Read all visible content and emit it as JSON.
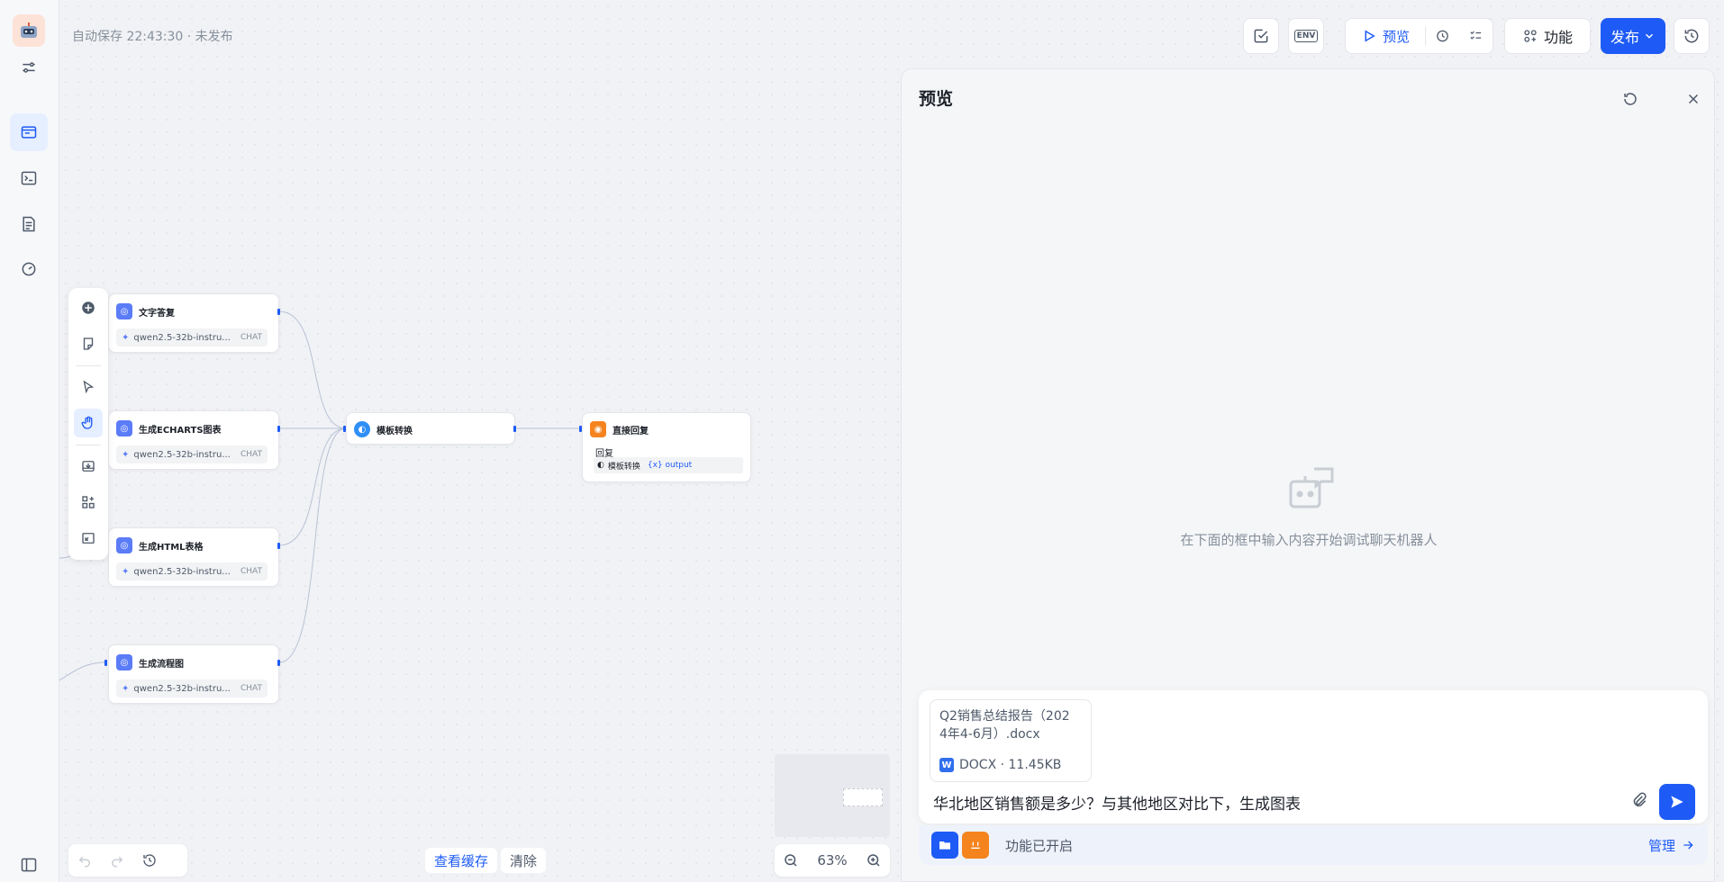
{
  "header": {
    "autosave": "自动保存 22:43:30 · 未发布",
    "env_label": "ENV",
    "preview_label": "预览",
    "function_label": "功能",
    "publish_label": "发布"
  },
  "canvas": {
    "nodes": [
      {
        "title": "文字答复",
        "model": "qwen2.5-32b-instru...",
        "tag": "CHAT"
      },
      {
        "title": "生成ECHARTS图表",
        "model": "qwen2.5-32b-instru...",
        "tag": "CHAT"
      },
      {
        "title": "生成HTML表格",
        "model": "qwen2.5-32b-instru...",
        "tag": "CHAT"
      },
      {
        "title": "生成流程图",
        "model": "qwen2.5-32b-instru...",
        "tag": "CHAT"
      }
    ],
    "template_node": {
      "title": "模板转换"
    },
    "reply_node": {
      "title": "直接回复",
      "section": "回复",
      "source": "模板转换",
      "var": "{x} output"
    },
    "view_cache": "查看缓存",
    "clear": "清除",
    "zoom": "63%"
  },
  "preview_panel": {
    "title": "预览",
    "empty_hint": "在下面的框中输入内容开始调试聊天机器人",
    "file": {
      "name": "Q2销售总结报告（2024年4-6月）.docx",
      "name_line1": "Q2销售总结报告（202",
      "name_line2": "4年4-6月）.docx",
      "meta": "DOCX · 11.45KB"
    },
    "query": "华北地区销售额是多少？与其他地区对比下，生成图表",
    "features_enabled": "功能已开启",
    "manage": "管理"
  },
  "colors": {
    "accent": "#1e5bf6",
    "orange": "#f5841f",
    "node_icon": "#5b7cf7"
  }
}
